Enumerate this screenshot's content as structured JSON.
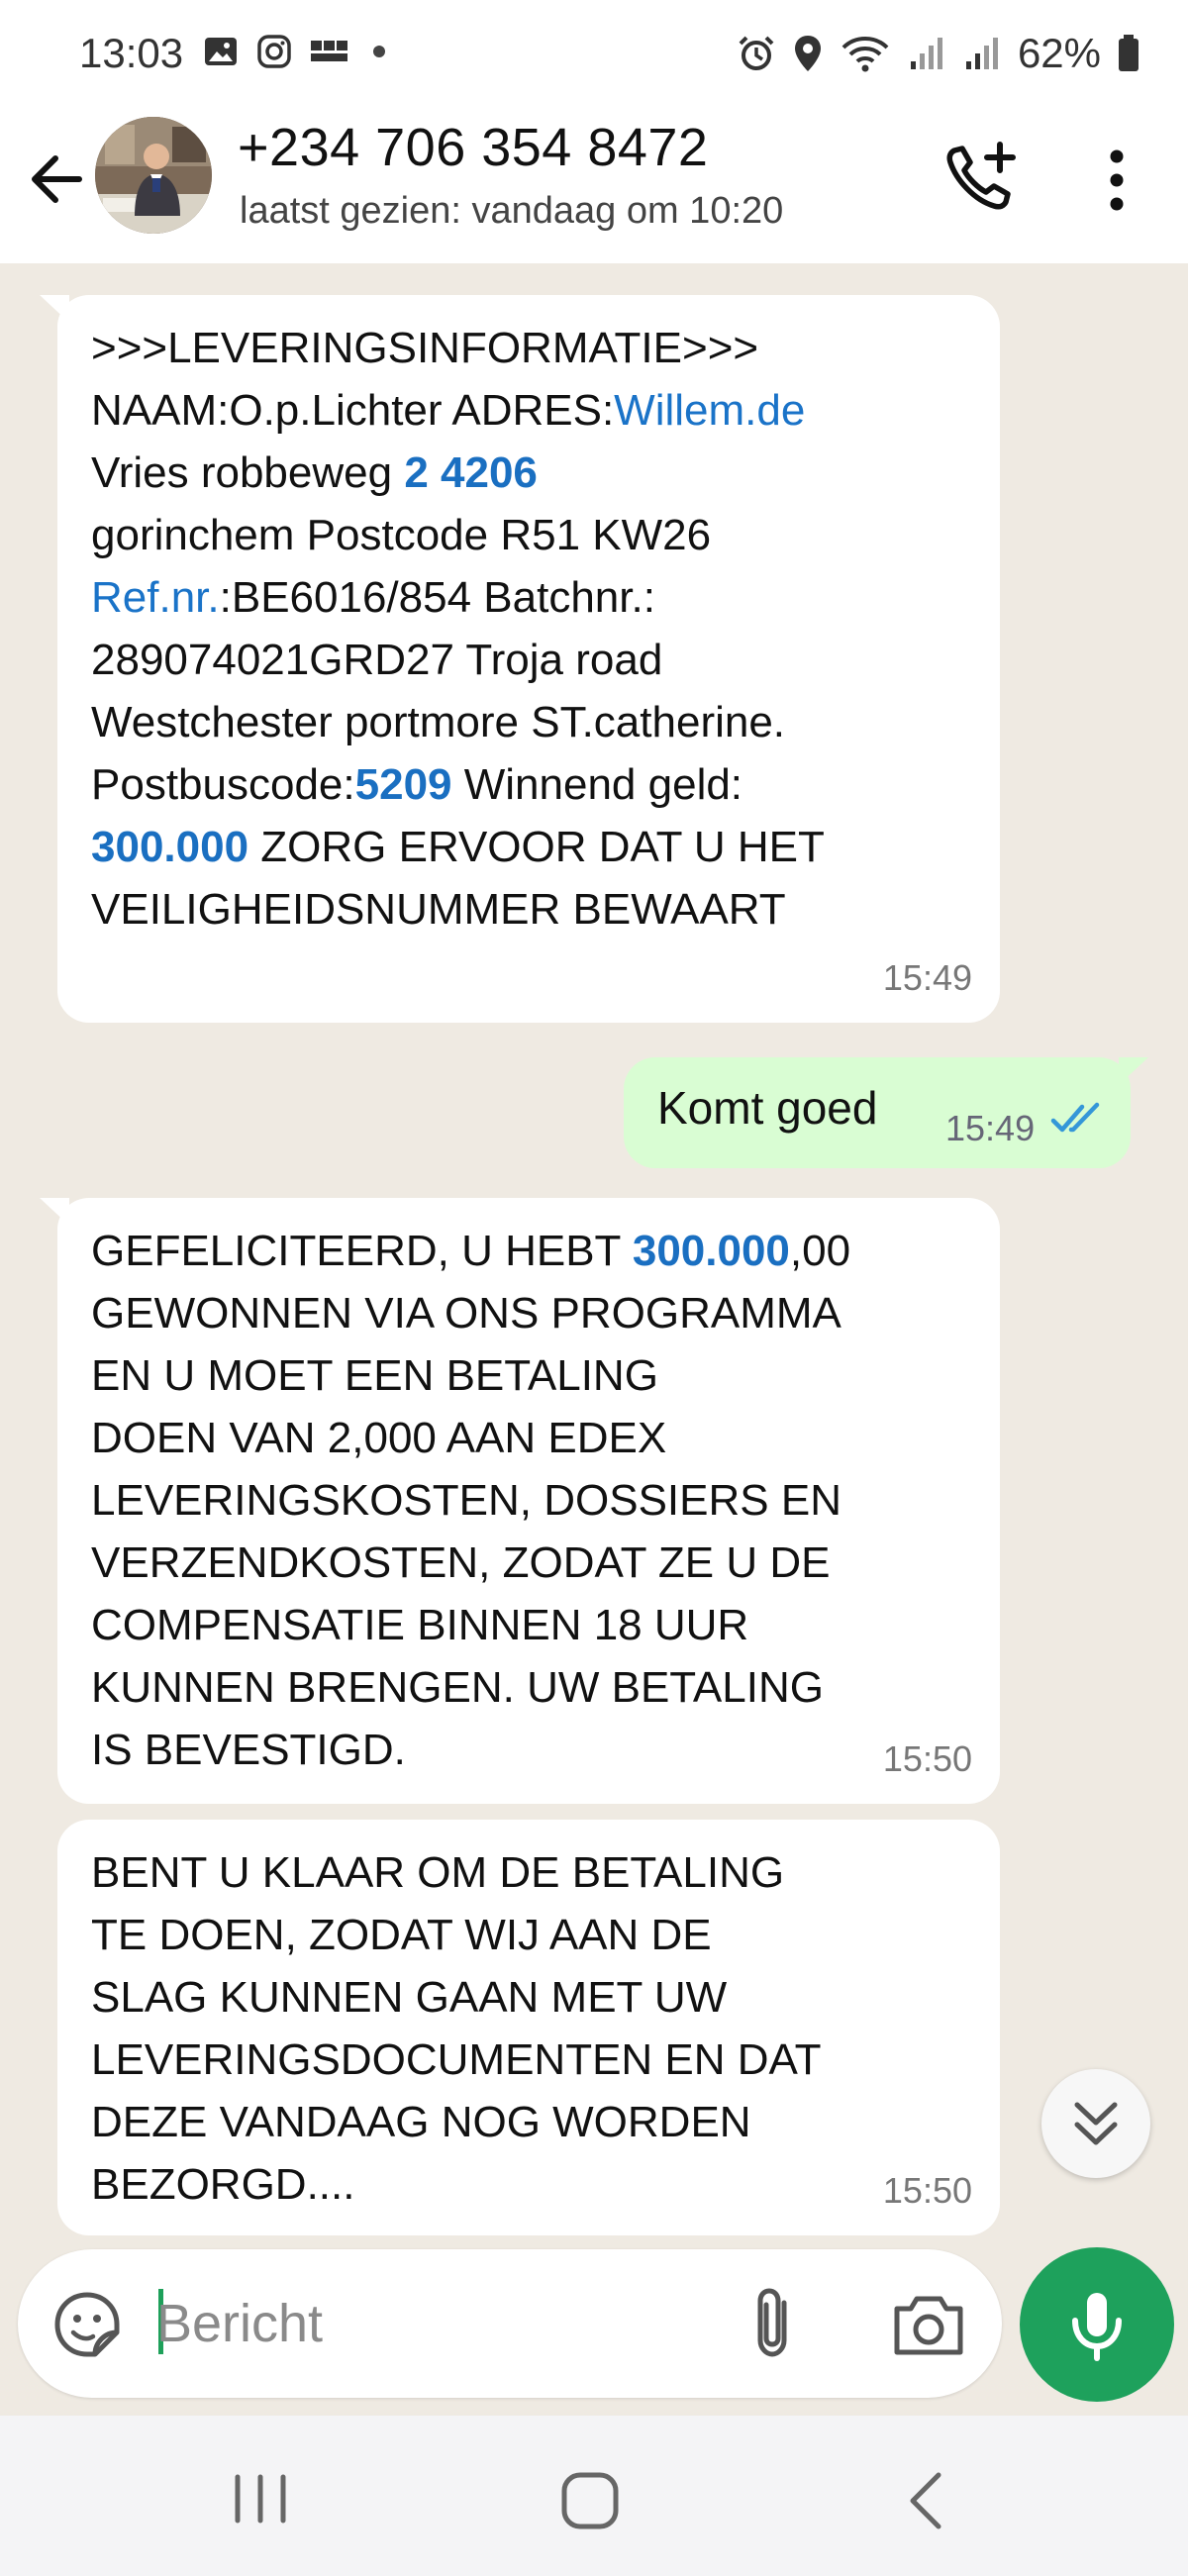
{
  "status_bar": {
    "time": "13:03",
    "battery": "62%",
    "left_icons": [
      "gallery-icon",
      "instagram-icon",
      "bbc-news-icon",
      "dot-icon"
    ],
    "right_icons": [
      "alarm-icon",
      "location-icon",
      "wifi-icon",
      "signal-icon",
      "signal-icon",
      "battery-icon"
    ]
  },
  "header": {
    "contact_name": "+234 706 354 8472",
    "last_seen": "laatst gezien: vandaag om 10:20"
  },
  "messages": [
    {
      "direction": "incoming",
      "time": "15:49",
      "lines": [
        [
          {
            "t": ">>>LEVERINGSINFORMATIE>>>"
          }
        ],
        [
          {
            "t": "NAAM:O.p.Lichter ADRES:"
          },
          {
            "t": "Willem.de",
            "s": "link"
          }
        ],
        [
          {
            "t": "Vries robbeweg "
          },
          {
            "t": "2 4206",
            "s": "bold"
          }
        ],
        [
          {
            "t": "gorinchem Postcode R51 KW26"
          }
        ],
        [
          {
            "t": "Ref.nr.",
            "s": "link"
          },
          {
            "t": ":BE6016/854 Batchnr.:"
          }
        ],
        [
          {
            "t": "289074021GRD27 Troja road"
          }
        ],
        [
          {
            "t": "Westchester portmore ST.catherine."
          }
        ],
        [
          {
            "t": " Postbuscode:"
          },
          {
            "t": "5209",
            "s": "bold"
          },
          {
            "t": " Winnend geld:"
          }
        ],
        [
          {
            "t": "300.000",
            "s": "bold"
          },
          {
            "t": " ZORG ERVOOR DAT U HET"
          }
        ],
        [
          {
            "t": "VEILIGHEIDSNUMMER BEWAART"
          }
        ]
      ]
    },
    {
      "direction": "outgoing",
      "time": "15:49",
      "text": "Komt goed",
      "status": "read"
    },
    {
      "direction": "incoming",
      "time": "15:50",
      "lines": [
        [
          {
            "t": "GEFELICITEERD, U HEBT "
          },
          {
            "t": "300.000",
            "s": "bold"
          },
          {
            "t": ",00"
          }
        ],
        [
          {
            "t": "GEWONNEN VIA ONS PROGRAMMA"
          }
        ],
        [
          {
            "t": "EN U MOET EEN BETALING"
          }
        ],
        [
          {
            "t": "DOEN VAN 2,000 AAN EDEX"
          }
        ],
        [
          {
            "t": "LEVERINGSKOSTEN, DOSSIERS EN"
          }
        ],
        [
          {
            "t": "VERZENDKOSTEN, ZODAT ZE U DE"
          }
        ],
        [
          {
            "t": "COMPENSATIE BINNEN 18 UUR"
          }
        ],
        [
          {
            "t": "KUNNEN BRENGEN. UW BETALING"
          }
        ],
        [
          {
            "t": "IS BEVESTIGD."
          }
        ]
      ]
    },
    {
      "direction": "incoming",
      "time": "15:50",
      "lines": [
        [
          {
            "t": "BENT U KLAAR OM DE BETALING"
          }
        ],
        [
          {
            "t": "TE DOEN, ZODAT WIJ AAN DE"
          }
        ],
        [
          {
            "t": "SLAG KUNNEN GAAN MET UW"
          }
        ],
        [
          {
            "t": "LEVERINGSDOCUMENTEN EN DAT"
          }
        ],
        [
          {
            "t": "DEZE VANDAAG NOG WORDEN"
          }
        ],
        [
          {
            "t": "BEZORGD...."
          }
        ]
      ]
    }
  ],
  "composer": {
    "placeholder": "Bericht",
    "value": ""
  },
  "colors": {
    "accent_green": "#1ea15c",
    "chat_background": "#efeae2",
    "outgoing_bubble": "#d9fdd3",
    "link_blue": "#1a73c8",
    "read_ticks": "#3497d8"
  }
}
